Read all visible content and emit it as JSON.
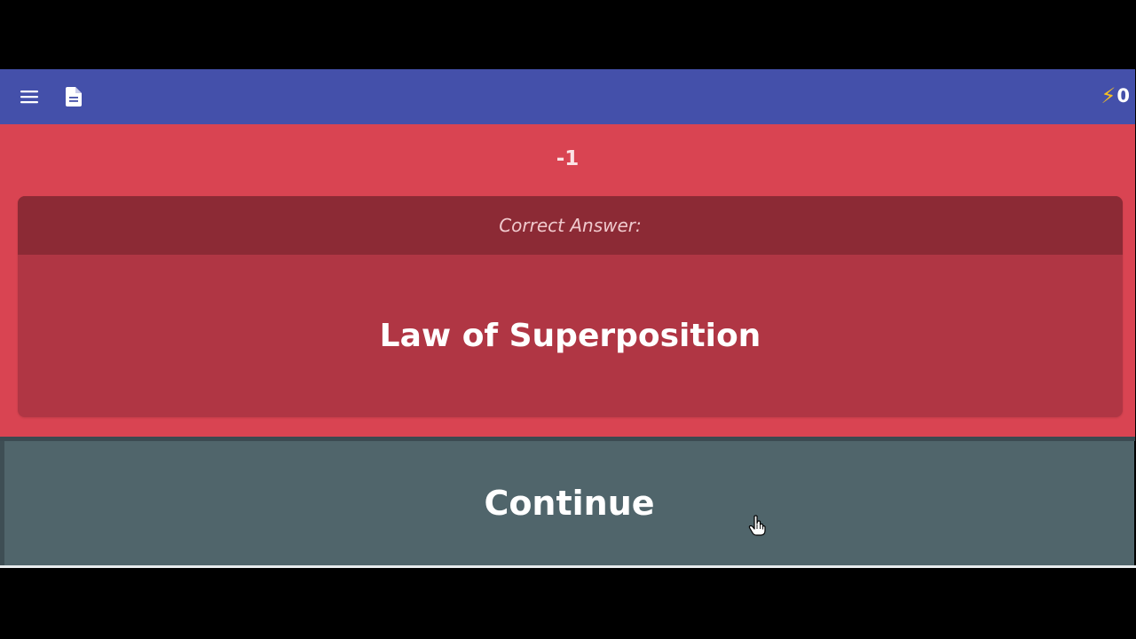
{
  "topbar": {
    "menu_icon": "hamburger-menu-icon",
    "document_icon": "document-icon",
    "energy_icon": "lightning-bolt-icon",
    "energy_count": "0"
  },
  "result": {
    "score_change": "-1",
    "answer_header": "Correct Answer:",
    "answer_text": "Law of Superposition"
  },
  "actions": {
    "continue_label": "Continue"
  },
  "colors": {
    "topbar": "#4450aa",
    "incorrect_background": "#d94452",
    "answer_card": "#b03644",
    "answer_header": "#8c2a35",
    "continue_button": "#50656b",
    "energy_bolt": "#f6c022"
  }
}
